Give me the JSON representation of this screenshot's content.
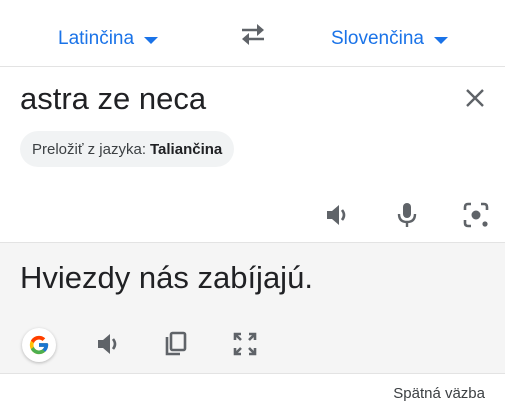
{
  "language_bar": {
    "source_language": "Latinčina",
    "target_language": "Slovenčina"
  },
  "source": {
    "text": "astra ze neca",
    "detect_prefix": "Preložiť z jazyka:",
    "detect_language": "Taliančina"
  },
  "target": {
    "text": "Hviezdy nás zabíjajú."
  },
  "footer": {
    "feedback_label": "Spätná väzba"
  },
  "colors": {
    "accent": "#1a73e8",
    "icon": "#5f6368",
    "target_bg": "#f5f5f5"
  },
  "icons": {
    "swap": "swap-arrows-icon",
    "clear": "close-icon",
    "listen": "speaker-icon",
    "mic": "microphone-icon",
    "camera": "camera-lens-icon",
    "google": "google-g-icon",
    "copy": "copy-icon",
    "fullscreen": "fullscreen-icon",
    "caret": "caret-down-icon"
  }
}
